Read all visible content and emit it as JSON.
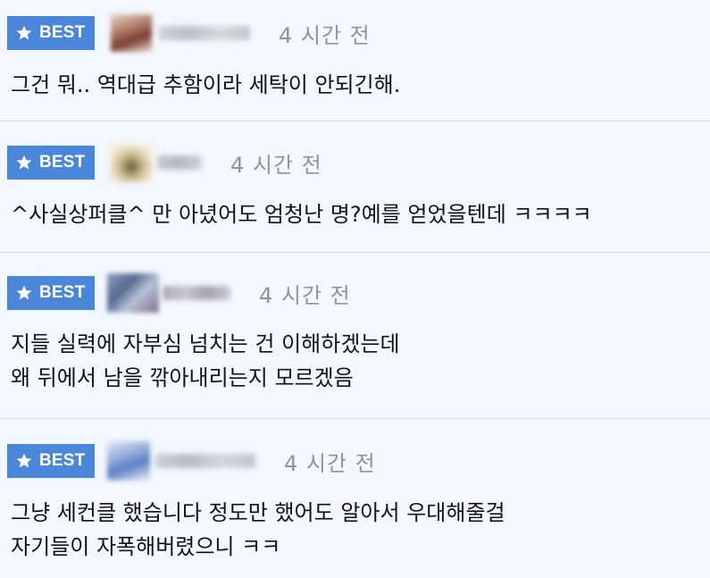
{
  "badge_label": "BEST",
  "colors": {
    "background": "#f3f7fe",
    "badge_blue": "#4a86d9",
    "time_gray": "#8e959f",
    "divider": "#d7dee8"
  },
  "comments": [
    {
      "time": "4 시간 전",
      "lines": [
        "그건 뭐.. 역대급 추함이라 세탁이 안되긴해."
      ]
    },
    {
      "time": "4 시간 전",
      "lines": [
        "^사실상퍼클^ 만 아녔어도 엄청난 명?예를 얻었을텐데 ㅋㅋㅋㅋ"
      ]
    },
    {
      "time": "4 시간 전",
      "lines": [
        "지들 실력에 자부심 넘치는 건 이해하겠는데",
        "왜 뒤에서 남을 깎아내리는지 모르겠음"
      ]
    },
    {
      "time": "4 시간 전",
      "lines": [
        "그냥 세컨클 했습니다 정도만 했어도 알아서 우대해줄걸",
        "자기들이 자폭해버렸으니 ㅋㅋ"
      ]
    }
  ]
}
